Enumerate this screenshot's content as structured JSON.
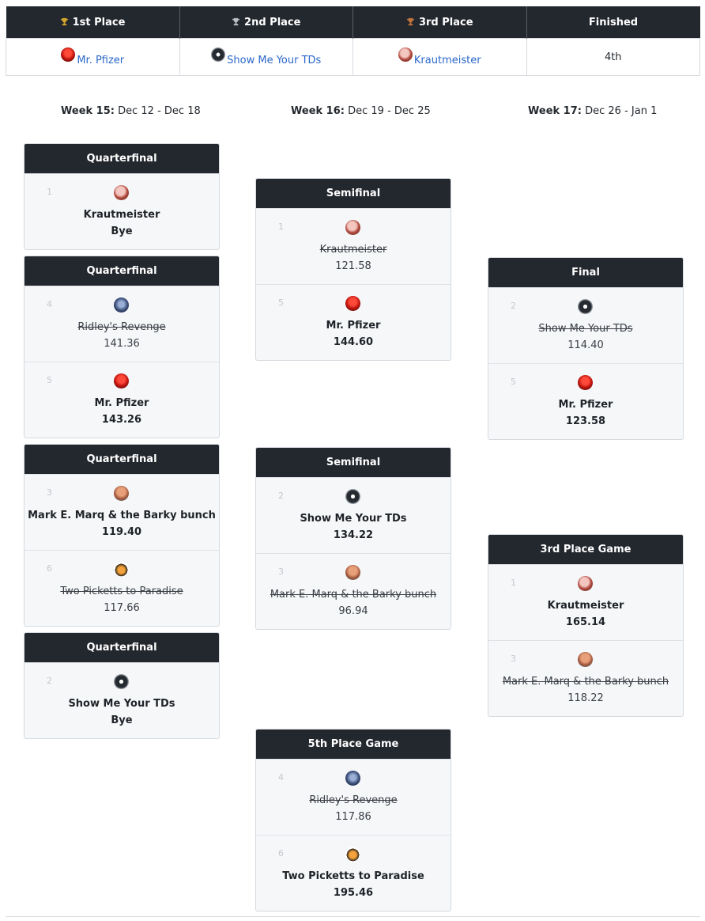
{
  "standings": {
    "headers": [
      "1st Place",
      "2nd Place",
      "3rd Place",
      "Finished"
    ],
    "values": [
      "Mr. Pfizer",
      "Show Me Your TDs",
      "Krautmeister",
      "4th"
    ]
  },
  "weeks": [
    {
      "label": "Week 15:",
      "range": "Dec 12 - Dec 18"
    },
    {
      "label": "Week 16:",
      "range": "Dec 19 - Dec 25"
    },
    {
      "label": "Week 17:",
      "range": "Dec 26 - Jan 1"
    }
  ],
  "matches": [
    {
      "title": "Quarterfinal",
      "teams": [
        {
          "seed": "1",
          "name": "Krautmeister",
          "score": "Bye"
        }
      ]
    },
    {
      "title": "Quarterfinal",
      "teams": [
        {
          "seed": "4",
          "name": "Ridley's Revenge",
          "score": "141.36"
        },
        {
          "seed": "5",
          "name": "Mr. Pfizer",
          "score": "143.26"
        }
      ]
    },
    {
      "title": "Quarterfinal",
      "teams": [
        {
          "seed": "3",
          "name": "Mark E. Marq & the Barky bunch",
          "score": "119.40"
        },
        {
          "seed": "6",
          "name": "Two Picketts to Paradise",
          "score": "117.66"
        }
      ]
    },
    {
      "title": "Quarterfinal",
      "teams": [
        {
          "seed": "2",
          "name": "Show Me Your TDs",
          "score": "Bye"
        }
      ]
    },
    {
      "title": "Semifinal",
      "teams": [
        {
          "seed": "1",
          "name": "Krautmeister",
          "score": "121.58"
        },
        {
          "seed": "5",
          "name": "Mr. Pfizer",
          "score": "144.60"
        }
      ]
    },
    {
      "title": "Semifinal",
      "teams": [
        {
          "seed": "2",
          "name": "Show Me Your TDs",
          "score": "134.22"
        },
        {
          "seed": "3",
          "name": "Mark E. Marq & the Barky bunch",
          "score": "96.94"
        }
      ]
    },
    {
      "title": "5th Place Game",
      "teams": [
        {
          "seed": "4",
          "name": "Ridley's Revenge",
          "score": "117.86"
        },
        {
          "seed": "6",
          "name": "Two Picketts to Paradise",
          "score": "195.46"
        }
      ]
    },
    {
      "title": "Final",
      "teams": [
        {
          "seed": "2",
          "name": "Show Me Your TDs",
          "score": "114.40"
        },
        {
          "seed": "5",
          "name": "Mr. Pfizer",
          "score": "123.58"
        }
      ]
    },
    {
      "title": "3rd Place Game",
      "teams": [
        {
          "seed": "1",
          "name": "Krautmeister",
          "score": "165.14"
        },
        {
          "seed": "3",
          "name": "Mark E. Marq & the Barky bunch",
          "score": "118.22"
        }
      ]
    }
  ],
  "colors": {
    "header_bg": "#23272e",
    "link": "#2a67c9",
    "card_bg": "#f5f7f9"
  },
  "icons": {
    "trophy": "trophy-icon"
  }
}
